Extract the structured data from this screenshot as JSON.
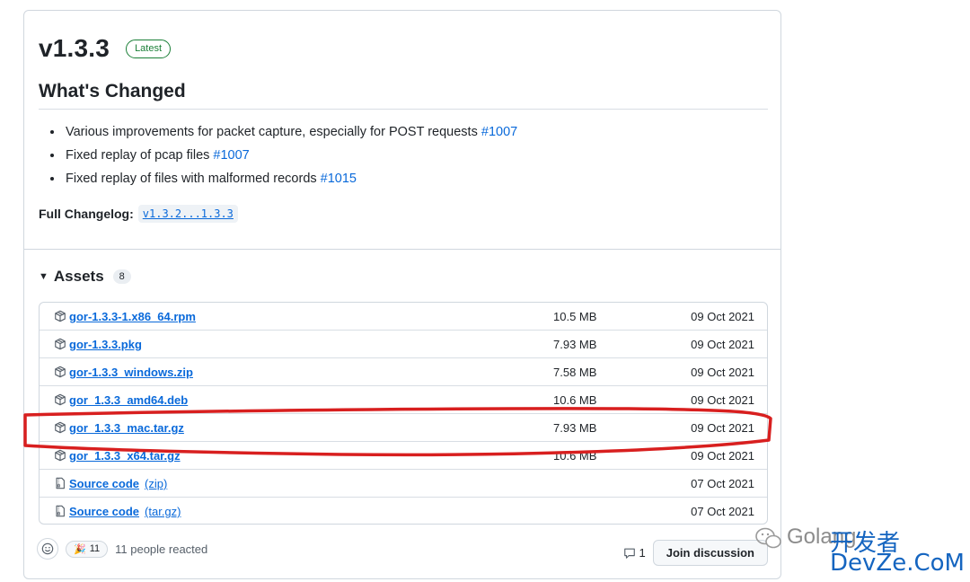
{
  "release": {
    "version": "v1.3.3",
    "badge": "Latest",
    "heading": "What's Changed",
    "notes": [
      {
        "text": "Various improvements for packet capture, especially for POST requests ",
        "ref": "#1007"
      },
      {
        "text": "Fixed replay of pcap files ",
        "ref": "#1007"
      },
      {
        "text": "Fixed replay of files with malformed records ",
        "ref": "#1015"
      }
    ],
    "changelog_label": "Full Changelog:",
    "changelog_link": "v1.3.2...1.3.3"
  },
  "assets": {
    "title": "Assets",
    "count": "8",
    "files": [
      {
        "name": "gor-1.3.3-1.x86_64.rpm",
        "size": "10.5 MB",
        "date": "09 Oct 2021",
        "icon": "package-icon"
      },
      {
        "name": "gor-1.3.3.pkg",
        "size": "7.93 MB",
        "date": "09 Oct 2021",
        "icon": "package-icon"
      },
      {
        "name": "gor-1.3.3_windows.zip",
        "size": "7.58 MB",
        "date": "09 Oct 2021",
        "icon": "package-icon"
      },
      {
        "name": "gor_1.3.3_amd64.deb",
        "size": "10.6 MB",
        "date": "09 Oct 2021",
        "icon": "package-icon"
      },
      {
        "name": "gor_1.3.3_mac.tar.gz",
        "size": "7.93 MB",
        "date": "09 Oct 2021",
        "icon": "package-icon"
      },
      {
        "name": "gor_1.3.3_x64.tar.gz",
        "size": "10.6 MB",
        "date": "09 Oct 2021",
        "icon": "package-icon"
      }
    ],
    "sources": [
      {
        "name": "Source code",
        "ext": "(zip)",
        "date": "07 Oct 2021",
        "icon": "file-zip-icon"
      },
      {
        "name": "Source code",
        "ext": "(tar.gz)",
        "date": "07 Oct 2021",
        "icon": "file-zip-icon"
      }
    ]
  },
  "reactions": {
    "emoji": "🎉",
    "count": "11",
    "text": "11 people reacted"
  },
  "discussion": {
    "comment_count": "1",
    "join_label": "Join discussion"
  },
  "watermark": {
    "line1": "Golang",
    "line1_cn": "开发者",
    "line2": "DevZe.CoM"
  },
  "colors": {
    "link": "#0969da",
    "latest_badge": "#1a7f37",
    "highlight_stroke": "#d81f1f"
  }
}
